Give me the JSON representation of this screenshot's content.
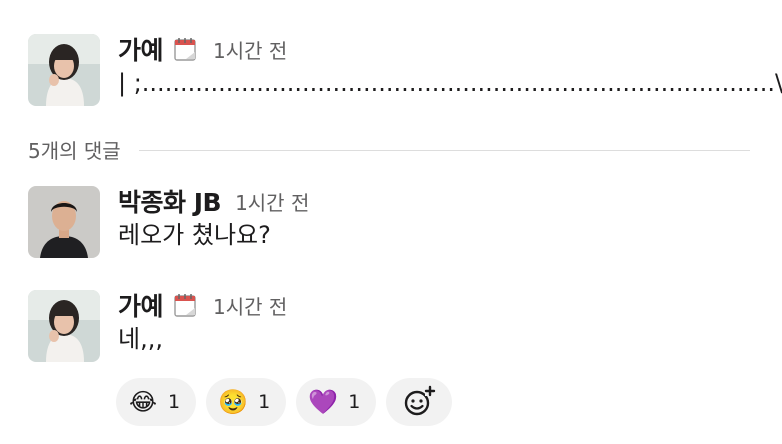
{
  "messages": [
    {
      "author": "가예",
      "status_icon": "notepad-icon",
      "time": "1시간 전",
      "text": "| ;...................................................................................\\"
    }
  ],
  "thread": {
    "reply_count_label": "5개의 댓글"
  },
  "replies": [
    {
      "author": "박종화 JB",
      "time": "1시간 전",
      "text": "레오가 쳤나요?"
    },
    {
      "author": "가예",
      "status_icon": "notepad-icon",
      "time": "1시간 전",
      "text": "네,,,"
    }
  ],
  "reactions": [
    {
      "emoji": "😂",
      "icon": "laughing-tears-emoji",
      "count": "1"
    },
    {
      "emoji": "🥹",
      "icon": "pleading-face-emoji",
      "count": "1"
    },
    {
      "emoji": "💜",
      "icon": "purple-heart-emoji",
      "count": "1"
    }
  ],
  "colors": {
    "text": "#1d1c1d",
    "muted": "#616061",
    "reaction_bg": "#f2f2f2",
    "divider": "#dddddd"
  }
}
